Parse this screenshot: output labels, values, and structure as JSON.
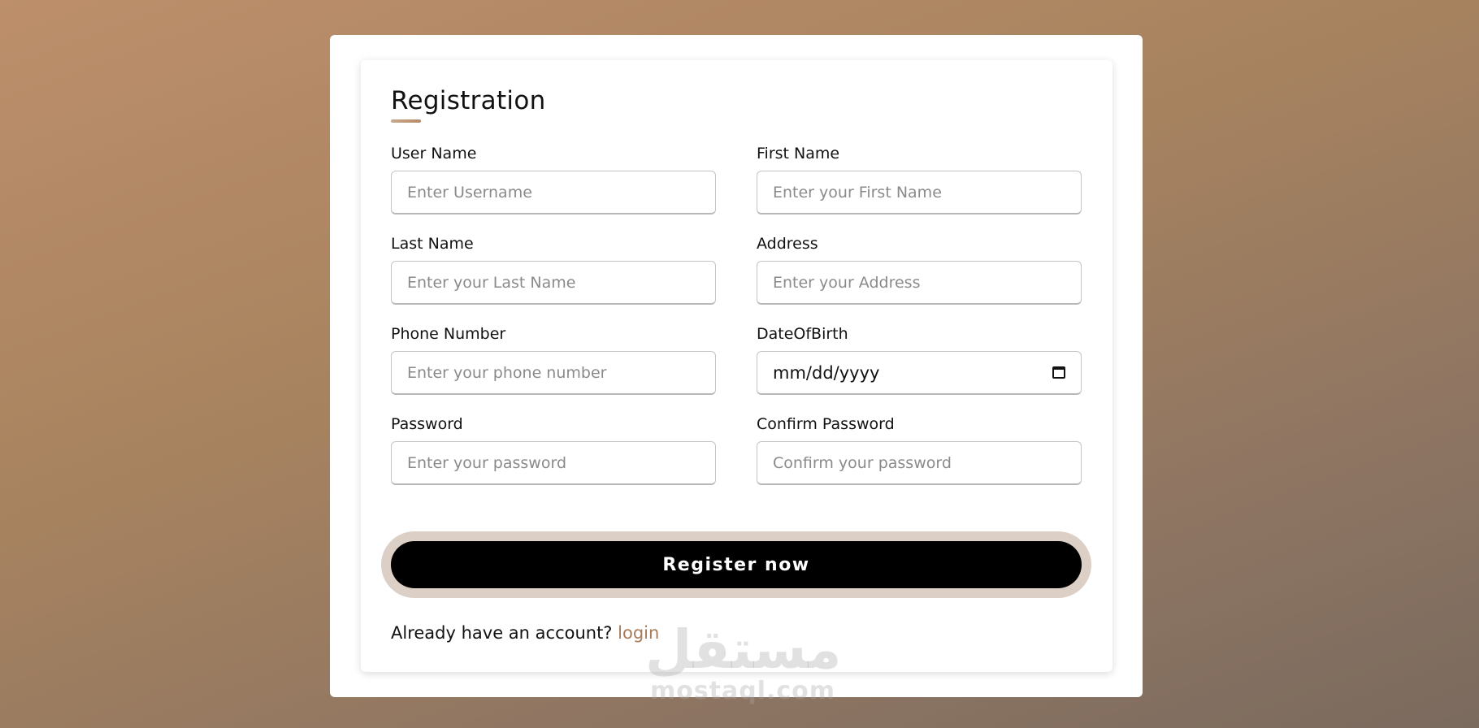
{
  "form": {
    "title": "Registration",
    "fields": {
      "username": {
        "label": "User Name",
        "placeholder": "Enter Username"
      },
      "first_name": {
        "label": "First Name",
        "placeholder": "Enter your First Name"
      },
      "last_name": {
        "label": "Last Name",
        "placeholder": "Enter your Last Name"
      },
      "address": {
        "label": "Address",
        "placeholder": "Enter your Address"
      },
      "phone": {
        "label": "Phone Number",
        "placeholder": "Enter your phone number"
      },
      "dob": {
        "label": "DateOfBirth",
        "value": "mm/dd/yyyy"
      },
      "password": {
        "label": "Password",
        "placeholder": "Enter your password"
      },
      "confirm_password": {
        "label": "Confirm Password",
        "placeholder": "Confirm your password"
      }
    },
    "submit_label": "Register now",
    "footer": {
      "text": "Already have an account? ",
      "link_label": "login"
    }
  },
  "watermark": {
    "arabic": "مستقل",
    "latin": "mostaql.com"
  },
  "colors": {
    "accent": "#a67c5b",
    "button": "#000000",
    "button_ring": "#dccfc6"
  },
  "icons": {
    "date_picker": "calendar-icon"
  }
}
